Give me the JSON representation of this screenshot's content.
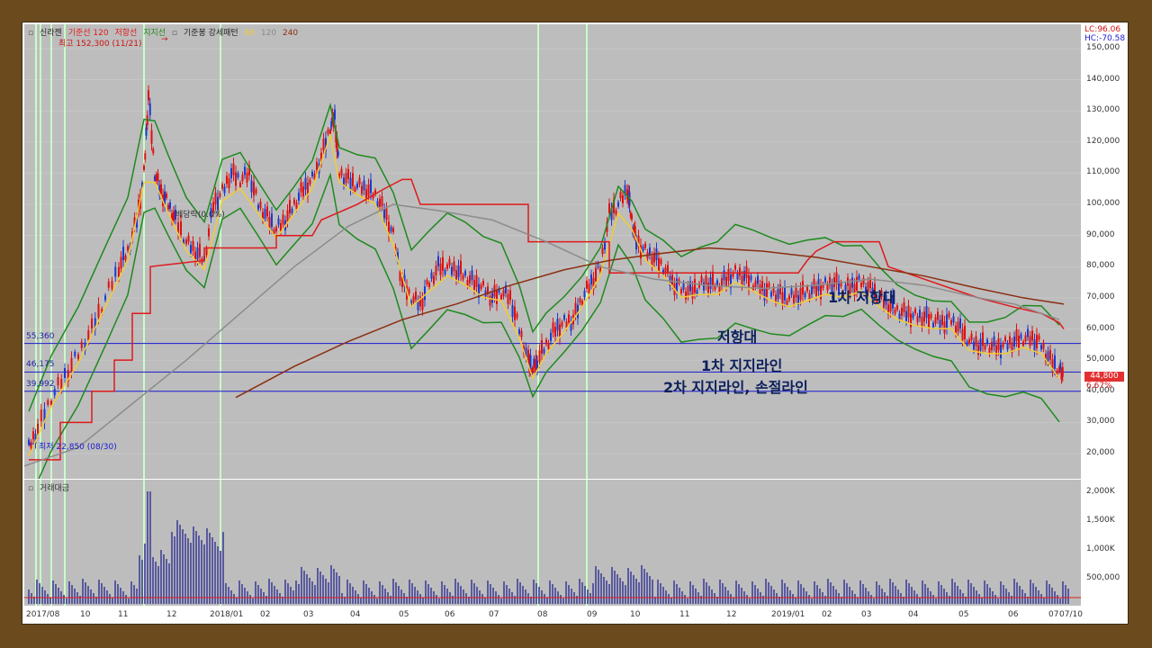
{
  "legend": {
    "name": "신라젠",
    "base_line": "기준선 120",
    "resistance": "저항선",
    "support": "지지선",
    "base_candle": "기준봉 강세패턴",
    "ma_a": "60",
    "ma_b": "120",
    "ma_c": "240"
  },
  "notes": {
    "high": "최고 152,300 (11/21)",
    "low": "최저 22,850 (08/30)",
    "dividend": "배당락(0.0%)"
  },
  "levels": [
    {
      "label": "55,360",
      "value": 55360
    },
    {
      "label": "46,175",
      "value": 46175
    },
    {
      "label": "39,992",
      "value": 39992
    }
  ],
  "annotations": {
    "res_zone": "저항대",
    "support1": "1차 지지라인",
    "support2": "2차 지지라인, 손절라인",
    "res1": "1차 저항대"
  },
  "price_axis": {
    "lc": "LC:96.06",
    "hc": "HC:-70.58",
    "current_price": "44,800",
    "change": "6.67%",
    "ticks": [
      "150,000",
      "140,000",
      "130,000",
      "120,000",
      "110,000",
      "100,000",
      "90,000",
      "80,000",
      "70,000",
      "60,000",
      "50,000",
      "40,000",
      "30,000",
      "20,000"
    ]
  },
  "volume": {
    "title": "거래대금",
    "ticks": [
      "2,000K",
      "1,500K",
      "1,000K",
      "500,000"
    ]
  },
  "date_axis": [
    "2017/08",
    "10",
    "11",
    "12",
    "2018/01",
    "02",
    "03",
    "04",
    "05",
    "06",
    "07",
    "08",
    "09",
    "10",
    "11",
    "12",
    "2019/01",
    "02",
    "03",
    "04",
    "05",
    "06",
    "07",
    "07/10"
  ],
  "colors": {
    "resistance": "#e0191b",
    "support": "#1e8a1e",
    "ma_yellow": "#f2cc33",
    "ma_gray": "#8c8c8c",
    "ma_brown": "#8b2e10",
    "level_line": "#1a1ad0",
    "volume_bar": "#5a5aa0",
    "highlight": "#c8ffc8"
  }
}
